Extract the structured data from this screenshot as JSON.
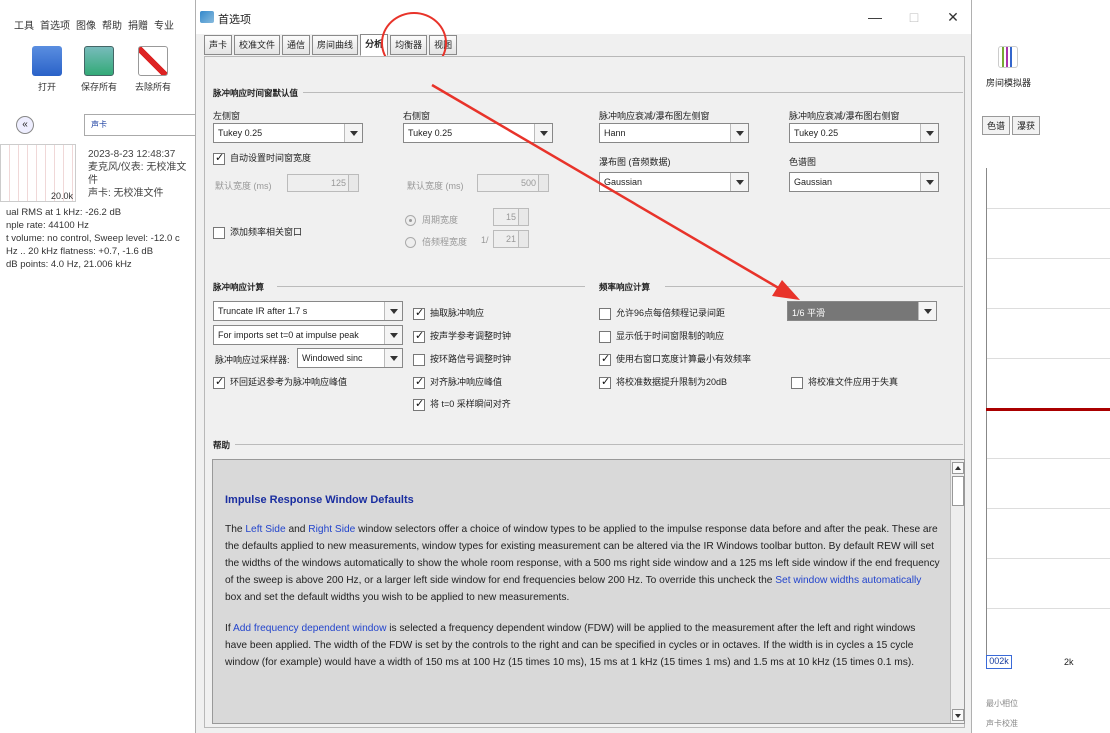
{
  "background_app": {
    "menu": [
      "工具",
      "首选项",
      "图像",
      "帮助",
      "捐赠",
      "专业"
    ],
    "toolbar": [
      {
        "label": "打开",
        "icon": "folder-icon"
      },
      {
        "label": "保存所有",
        "icon": "save-icon"
      },
      {
        "label": "去除所有",
        "icon": "remove-all-icon"
      }
    ],
    "measurement": {
      "name": "声卡",
      "graph_label": "20.0k",
      "date": "2023-8-23 12:48:37",
      "mic": "麦克风/仪表: 无校准文件",
      "soundcard": "声卡: 无校准文件",
      "stats": [
        "ual RMS at 1 kHz: -26.2 dB",
        "nple rate: 44100 Hz",
        "t volume: no control, Sweep level: -12.0 c",
        "Hz .. 20 kHz flatness: +0.7, -1.6 dB",
        "dB points: 4.0 Hz, 21.006 kHz"
      ]
    },
    "right": {
      "room_sim": "房间模拟器",
      "tabs": [
        "色谱",
        "瀑获"
      ],
      "axis_box": "002k",
      "axis_2k": "2k",
      "checks": [
        "最小相位",
        "声卡校准"
      ]
    }
  },
  "dialog": {
    "title": "首选项",
    "tabs": [
      "声卡",
      "校准文件",
      "通信",
      "房间曲线",
      "分析",
      "均衡器",
      "视图"
    ],
    "active_tab": "分析",
    "ir_window": {
      "title": "脉冲响应时间窗默认值",
      "left_label": "左侧窗",
      "left_value": "Tukey 0.25",
      "right_label": "右侧窗",
      "right_value": "Tukey 0.25",
      "decay_left_label": "脉冲响应衰减/瀑布图左侧窗",
      "decay_left_value": "Hann",
      "decay_right_label": "脉冲响应衰减/瀑布图右侧窗",
      "decay_right_value": "Tukey 0.25",
      "auto_width": "自动设置时间窗宽度",
      "default_width_left": "默认宽度 (ms)",
      "default_width_left_value": "125",
      "default_width_right": "默认宽度 (ms)",
      "default_width_right_value": "500",
      "waterfall_label": "瀑布图 (音频数据)",
      "waterfall_value": "Gaussian",
      "spectrogram_label": "色谱图",
      "spectrogram_value": "Gaussian",
      "add_fdw": "添加频率相关窗口",
      "cycles": "周期宽度",
      "cycles_value": "15",
      "octaves": "倍频程宽度",
      "octaves_prefix": "1/",
      "octaves_value": "21"
    },
    "ir_calc": {
      "title": "脉冲响应计算",
      "truncate": "Truncate IR after 1.7 s",
      "imports": "For imports set t=0 at impulse peak",
      "resampler_label": "脉冲响应过采样器:",
      "resampler_value": "Windowed sinc",
      "loopback_peak": "环回延迟参考为脉冲响应峰值",
      "extract": "抽取脉冲响应",
      "adjust_acoustic": "按声学参考调整时钟",
      "adjust_loopback": "按环路信号调整时钟",
      "align_peak": "对齐脉冲响应峰值",
      "align_t0": "将 t=0 采样瞬间对齐"
    },
    "fr_calc": {
      "title": "频率响应计算",
      "allow96": "允许96点每倍频程记录间距",
      "smoothing_value": "1/6 平滑",
      "show_below": "显示低于时间窗限制的响应",
      "use_right": "使用右窗口宽度计算最小有效频率",
      "lift_cal": "将校准数据提升限制为20dB",
      "apply_cal": "将校准文件应用于失真"
    },
    "help": {
      "title": "帮助",
      "heading": "Impulse Response Window Defaults",
      "p1_a": "The ",
      "p1_left": "Left Side",
      "p1_b": " and ",
      "p1_right": "Right Side",
      "p1_c": " window selectors offer a choice of window types to be applied to the impulse response data before and after the peak. These are the defaults applied to new measurements, window types for existing measurement can be altered via the IR Windows toolbar button. By default REW will set the widths of the windows automatically to show the whole room response, with a 500 ms right side window and a 125 ms left side window if the end frequency of the sweep is above 200 Hz, or a larger left side window for end frequencies below 200 Hz. To override this uncheck the ",
      "p1_link": "Set window widths automatically",
      "p1_d": " box and set the default widths you wish to be applied to new measurements.",
      "p2_a": "If ",
      "p2_link": "Add frequency dependent window",
      "p2_b": " is selected a frequency dependent window (FDW) will be applied to the measurement after the left and right windows have been applied. The width of the FDW is set by the controls to the right and can be specified in cycles or in octaves. If the width is in cycles a 15 cycle window (for example) would have a width of 150 ms at 100 Hz (15 times 10 ms), 15 ms at 1 kHz (15 times 1 ms) and 1.5 ms at 10 kHz (15 times 0.1 ms)."
    }
  }
}
